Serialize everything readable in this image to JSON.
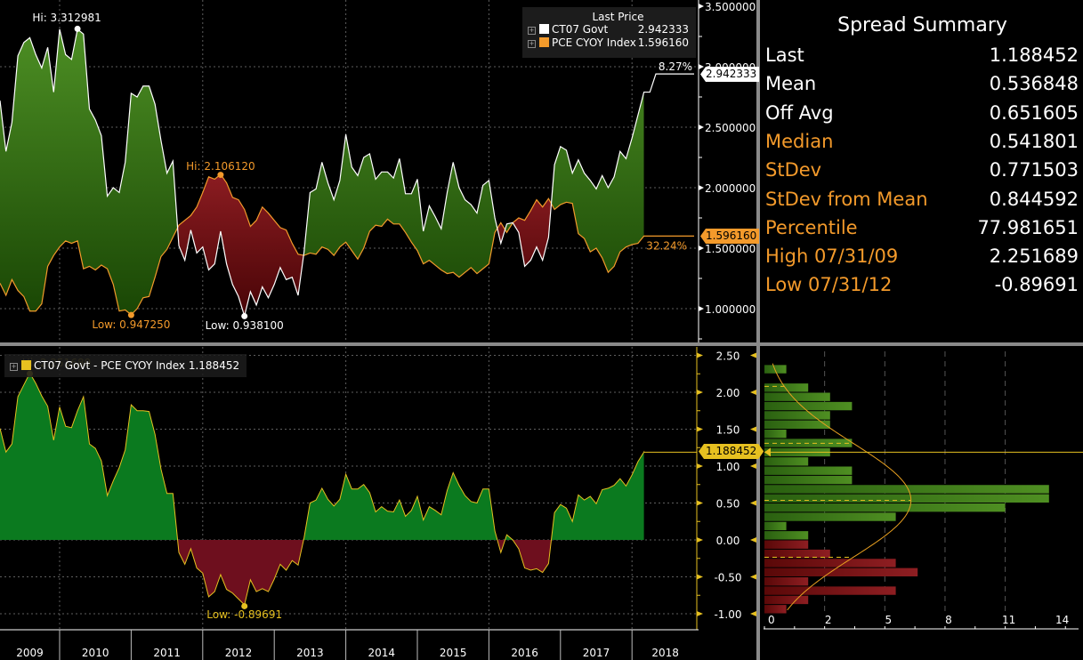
{
  "colors": {
    "white_series": "#ffffff",
    "orange_series": "#f39a2b",
    "spread": "#e6c020",
    "positive_fill": "#3f7f1c",
    "negative_fill": "#7a1420",
    "spread_pos": "#0b7a1f",
    "spread_neg": "#6e0f1e"
  },
  "chart_data": [
    {
      "type": "area",
      "title": "",
      "legend": {
        "title": "Last Price",
        "placement": "top-right"
      },
      "x_start": "2009-03",
      "x_frequency": "monthly",
      "x_ticks": [
        "2009",
        "2010",
        "2011",
        "2012",
        "2013",
        "2014",
        "2015",
        "2016",
        "2017",
        "2018"
      ],
      "y_ticks": [
        "3.500000",
        "3.000000",
        "2.500000",
        "2.000000",
        "1.500000",
        "1.000000"
      ],
      "ylim": [
        0.8,
        3.5
      ],
      "grid": true,
      "series": [
        {
          "name": "CT07 Govt",
          "last": "2.942333",
          "change_label": "8.27%",
          "values": [
            2.72,
            2.3,
            2.54,
            3.09,
            3.2,
            3.24,
            3.1,
            2.99,
            3.16,
            2.79,
            3.31,
            3.1,
            3.06,
            3.31,
            3.27,
            2.65,
            2.56,
            2.43,
            1.93,
            2.0,
            1.96,
            2.21,
            2.78,
            2.75,
            2.84,
            2.84,
            2.69,
            2.39,
            2.12,
            2.22,
            1.52,
            1.4,
            1.65,
            1.46,
            1.51,
            1.32,
            1.37,
            1.64,
            1.37,
            1.2,
            1.1,
            0.94,
            1.14,
            1.03,
            1.18,
            1.09,
            1.2,
            1.34,
            1.24,
            1.26,
            1.11,
            1.47,
            1.96,
            1.99,
            2.21,
            2.04,
            1.9,
            2.06,
            2.44,
            2.17,
            2.1,
            2.25,
            2.28,
            2.07,
            2.13,
            2.13,
            2.08,
            2.24,
            1.95,
            1.95,
            2.07,
            1.64,
            1.85,
            1.76,
            1.66,
            1.96,
            2.21,
            2.0,
            1.9,
            1.86,
            1.79,
            2.02,
            2.06,
            1.75,
            1.54,
            1.7,
            1.71,
            1.63,
            1.35,
            1.4,
            1.51,
            1.4,
            1.59,
            2.19,
            2.34,
            2.31,
            2.12,
            2.23,
            2.12,
            2.06,
            1.99,
            2.1,
            2.0,
            2.09,
            2.3,
            2.24,
            2.41,
            2.6,
            2.79,
            2.79,
            2.94
          ],
          "hi": {
            "label": "Hi: 3.312981",
            "index": 13,
            "value": 3.312981
          },
          "low": {
            "label": "Low: 0.938100",
            "index": 41,
            "value": 0.9381
          }
        },
        {
          "name": "PCE CYOY Index",
          "last": "1.596160",
          "change_label": "32.24%",
          "values": [
            1.21,
            1.11,
            1.24,
            1.15,
            1.1,
            0.98,
            0.98,
            1.04,
            1.35,
            1.44,
            1.51,
            1.56,
            1.54,
            1.56,
            1.33,
            1.35,
            1.32,
            1.36,
            1.33,
            1.2,
            0.98,
            0.99,
            0.95,
            1.0,
            1.09,
            1.1,
            1.26,
            1.43,
            1.49,
            1.59,
            1.69,
            1.73,
            1.77,
            1.84,
            1.96,
            2.09,
            2.07,
            2.11,
            2.04,
            1.92,
            1.9,
            1.82,
            1.68,
            1.73,
            1.84,
            1.79,
            1.73,
            1.67,
            1.65,
            1.54,
            1.45,
            1.44,
            1.46,
            1.45,
            1.51,
            1.49,
            1.44,
            1.51,
            1.55,
            1.48,
            1.41,
            1.5,
            1.64,
            1.69,
            1.68,
            1.74,
            1.7,
            1.7,
            1.63,
            1.55,
            1.48,
            1.37,
            1.4,
            1.36,
            1.32,
            1.29,
            1.3,
            1.26,
            1.3,
            1.34,
            1.29,
            1.33,
            1.37,
            1.63,
            1.71,
            1.63,
            1.71,
            1.75,
            1.73,
            1.81,
            1.9,
            1.84,
            1.91,
            1.82,
            1.86,
            1.88,
            1.87,
            1.62,
            1.58,
            1.47,
            1.5,
            1.42,
            1.3,
            1.35,
            1.47,
            1.51,
            1.53,
            1.54,
            1.6
          ],
          "hi": {
            "label": "Hi: 2.106120",
            "index": 37,
            "value": 2.10612
          },
          "low": {
            "label": "Low: 0.947250",
            "index": 22,
            "value": 0.94725
          }
        }
      ]
    },
    {
      "type": "area",
      "title": "",
      "series": [
        {
          "name": "CT07 Govt - PCE CYOY Index",
          "last": "1.188452",
          "derived": "CT07 Govt minus PCE CYOY Index"
        }
      ],
      "y_ticks": [
        "2.50",
        "2.00",
        "1.50",
        "1.00",
        "0.50",
        "0.00",
        "-0.50",
        "-1.00"
      ],
      "ylim": [
        -1.0,
        2.5
      ],
      "grid": true,
      "hi": {
        "label": "Hi: 2.251689",
        "value": 2.251689
      },
      "low": {
        "label": "Low: -0.89691",
        "value": -0.89691
      }
    },
    {
      "type": "bar",
      "orientation": "horizontal",
      "title": "",
      "bin_start": -1.0,
      "bin_width": 0.125,
      "counts": [
        1,
        2,
        6,
        2,
        7,
        6,
        3,
        2,
        2,
        1,
        6,
        11,
        13,
        13,
        4,
        4,
        2,
        3,
        4,
        1,
        3,
        3,
        4,
        3,
        2,
        0,
        1
      ],
      "x_ticks": [
        "0",
        "2",
        "5",
        "8",
        "11",
        "14"
      ],
      "xlim": [
        0,
        14
      ],
      "normal_curve": {
        "mean": 0.536848,
        "stdev": 0.771503
      },
      "current": 1.188452
    }
  ],
  "legend_upper": {
    "title": "Last Price",
    "items": [
      {
        "name": "CT07 Govt",
        "value": "2.942333",
        "color": "#ffffff"
      },
      {
        "name": "PCE CYOY Index",
        "value": "1.596160",
        "color": "#f39a2b"
      }
    ]
  },
  "legend_lower": {
    "label": "CT07 Govt - PCE CYOY Index 1.188452",
    "color": "#e6c020"
  },
  "summary": {
    "title": "Spread Summary",
    "rows": [
      {
        "label": "Last",
        "value": "1.188452",
        "style": "white"
      },
      {
        "label": "Mean",
        "value": "0.536848",
        "style": "white"
      },
      {
        "label": "Off Avg",
        "value": "0.651605",
        "style": "white"
      },
      {
        "label": "Median",
        "value": "0.541801",
        "style": "orange"
      },
      {
        "label": "StDev",
        "value": "0.771503",
        "style": "orange"
      },
      {
        "label": "StDev from Mean",
        "value": "0.844592",
        "style": "orange"
      },
      {
        "label": "Percentile",
        "value": "77.981651",
        "style": "orange"
      },
      {
        "label": "High 07/31/09",
        "value": "2.251689",
        "style": "orange"
      },
      {
        "label": "Low 07/31/12",
        "value": "-0.89691",
        "style": "orange"
      }
    ]
  }
}
